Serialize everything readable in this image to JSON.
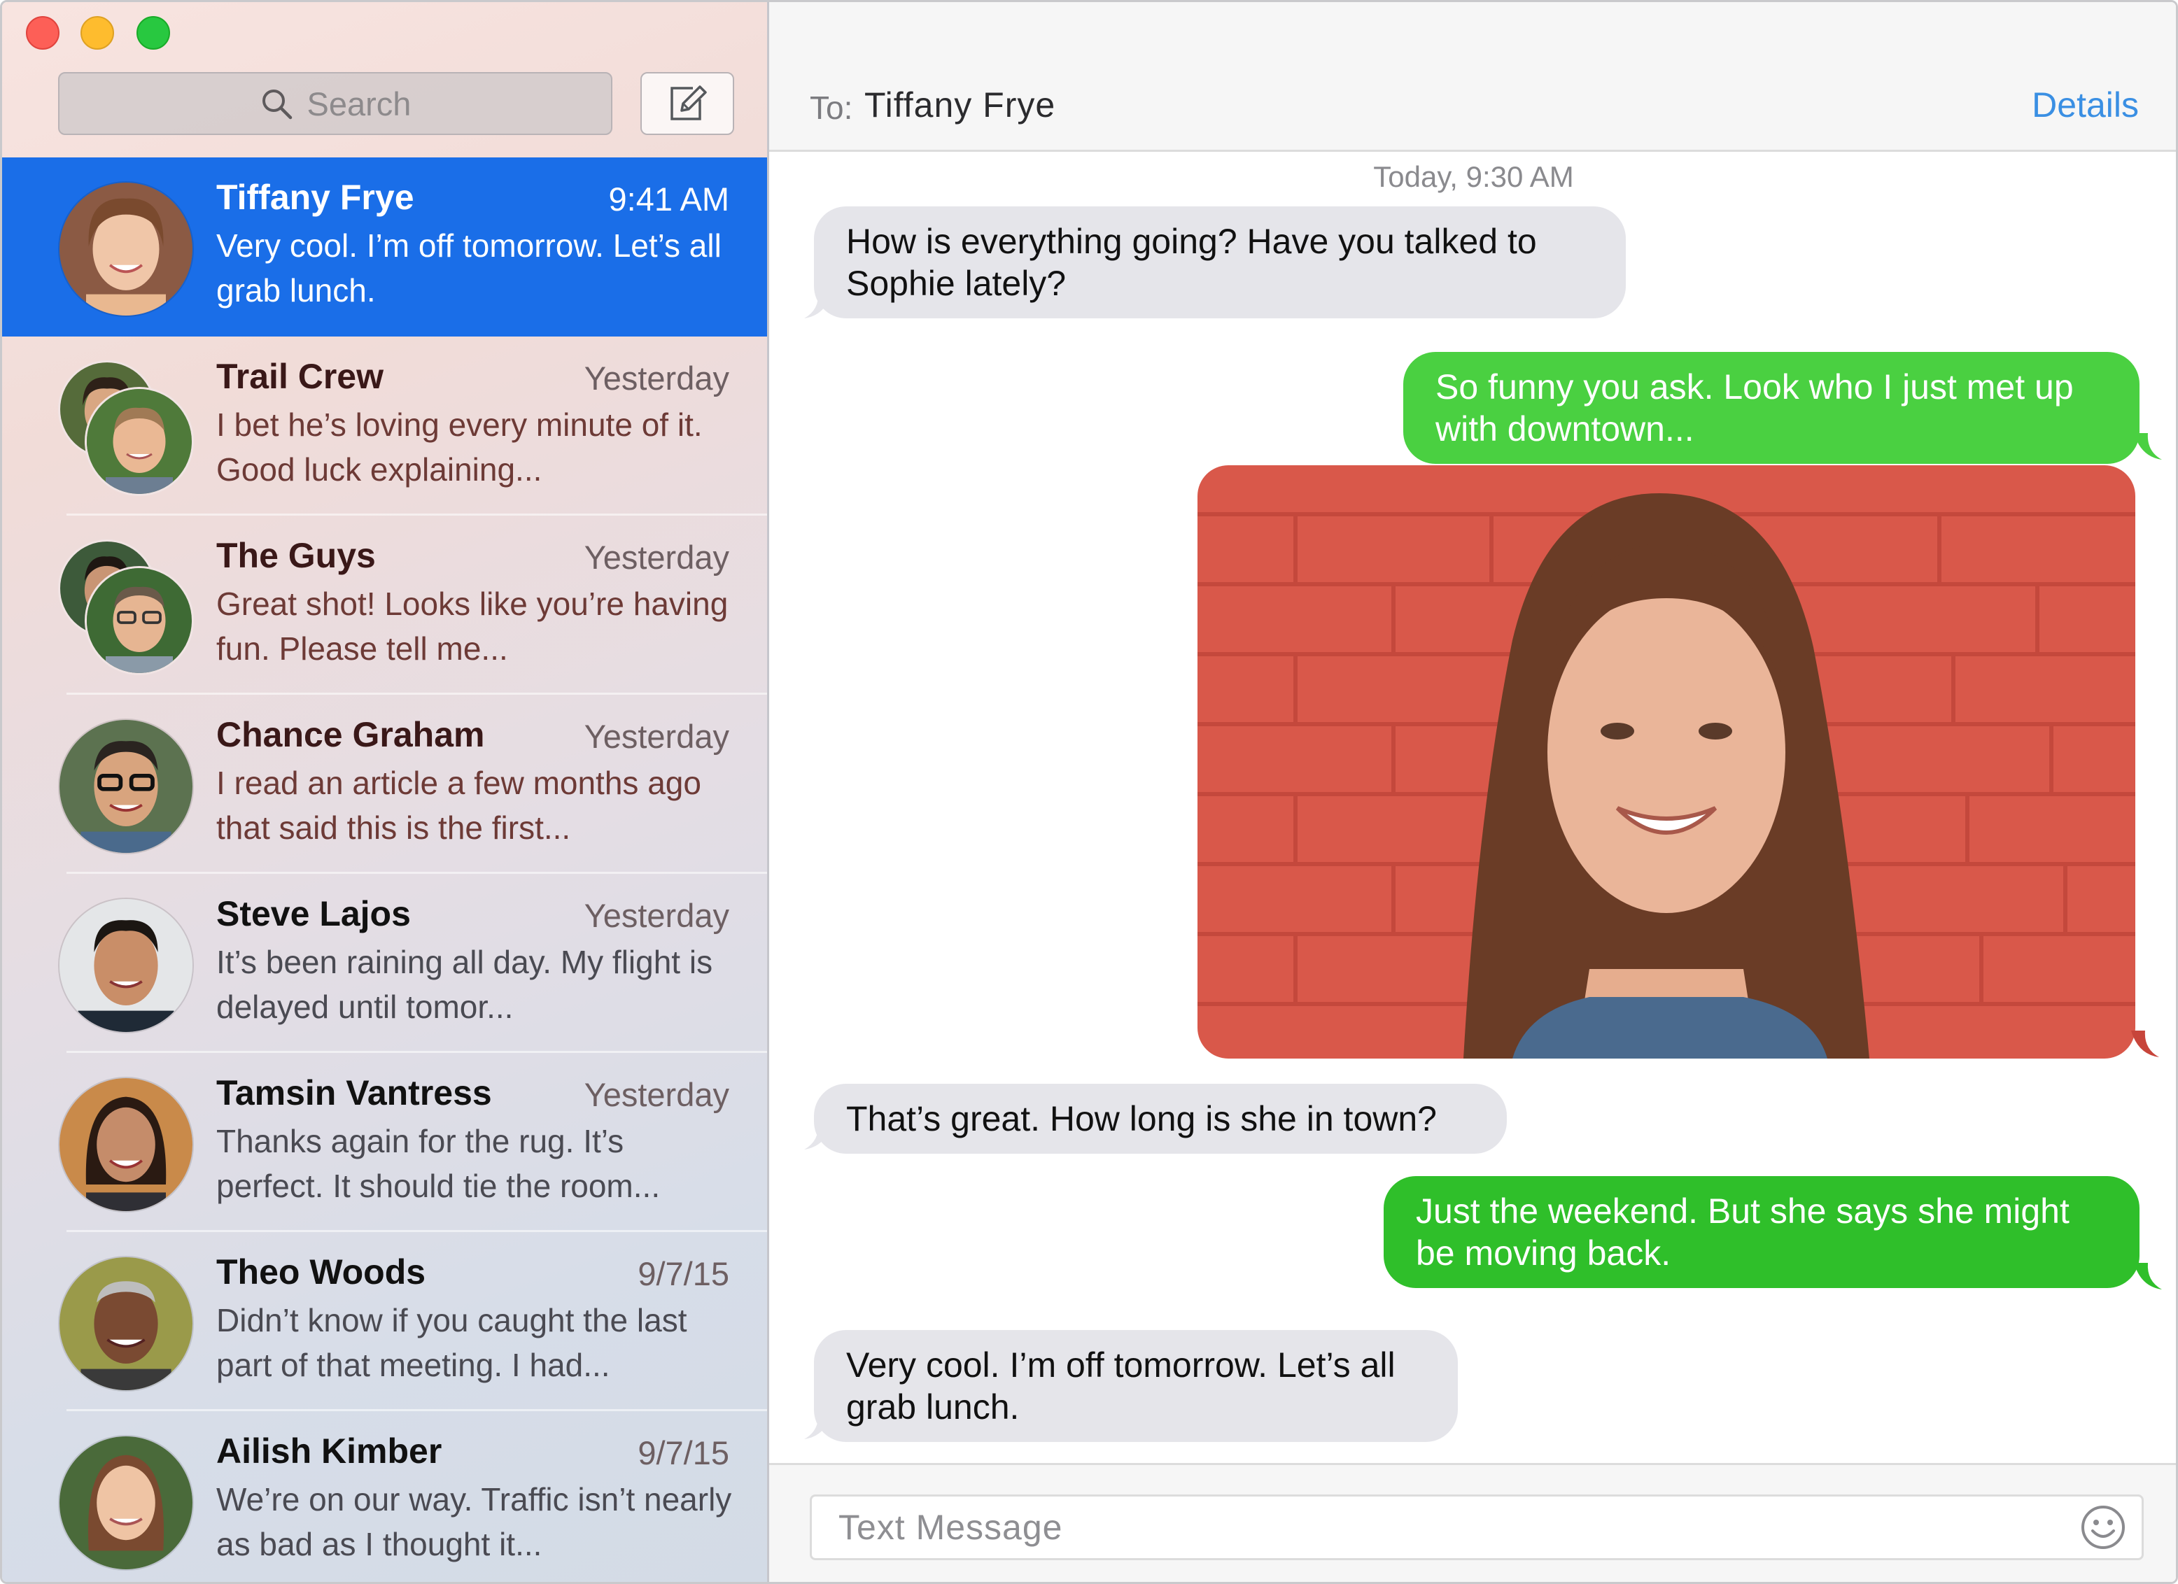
{
  "window": {
    "controls": [
      "close",
      "minimize",
      "zoom"
    ]
  },
  "sidebar": {
    "search": {
      "placeholder": "Search",
      "icon": "magnifier-icon"
    },
    "compose": {
      "icon": "compose-icon"
    },
    "conversations": [
      {
        "name": "Tiffany Frye",
        "time": "9:41 AM",
        "preview": "Very cool. I’m off tomorrow. Let’s all grab lunch.",
        "selected": true
      },
      {
        "name": "Trail Crew",
        "time": "Yesterday",
        "preview": "I bet he’s loving every minute of it. Good luck explaining...",
        "group": true
      },
      {
        "name": "The Guys",
        "time": "Yesterday",
        "preview": "Great shot! Looks like you’re having fun. Please tell me...",
        "group": true
      },
      {
        "name": "Chance Graham",
        "time": "Yesterday",
        "preview": "I read an article a few months ago that said this is the first..."
      },
      {
        "name": "Steve Lajos",
        "time": "Yesterday",
        "preview": "It’s been raining all day. My flight is delayed until tomor..."
      },
      {
        "name": "Tamsin Vantress",
        "time": "Yesterday",
        "preview": "Thanks again for the rug. It’s perfect. It should tie the room..."
      },
      {
        "name": "Theo Woods",
        "time": "9/7/15",
        "preview": "Didn’t know if you caught the last part of that meeting. I had..."
      },
      {
        "name": "Ailish Kimber",
        "time": "9/7/15",
        "preview": "We’re on our way. Traffic isn’t nearly as bad as I thought it..."
      }
    ]
  },
  "header": {
    "to_label": "To:",
    "recipient": "Tiffany Frye",
    "details_label": "Details"
  },
  "thread": {
    "timestamp": "Today, 9:30 AM",
    "messages": [
      {
        "direction": "incoming",
        "text": "How is everything going? Have you talked to Sophie lately?"
      },
      {
        "direction": "outgoing",
        "text": "So funny you ask. Look who I just met up with downtown..."
      },
      {
        "direction": "outgoing",
        "type": "photo",
        "description": "photo-attachment"
      },
      {
        "direction": "incoming",
        "text": "That’s great. How long is she in town?"
      },
      {
        "direction": "outgoing",
        "text": "Just the weekend. But she says she might be moving back."
      },
      {
        "direction": "incoming",
        "text": "Very cool. I’m off tomorrow. Let’s all grab lunch."
      }
    ]
  },
  "composer": {
    "placeholder": "Text Message",
    "emoji_icon": "emoji-icon"
  },
  "colors": {
    "selected_row": "#1a6ee8",
    "outgoing_bubble": "#4ad041",
    "incoming_bubble": "#e5e5ea",
    "link": "#3a8fe3"
  }
}
